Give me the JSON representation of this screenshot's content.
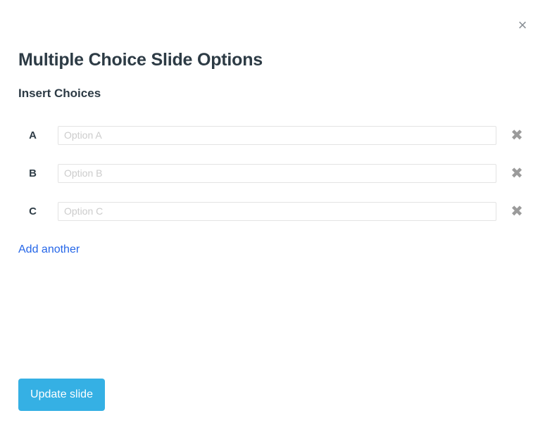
{
  "dialog": {
    "title": "Multiple Choice Slide Options",
    "section_title": "Insert Choices",
    "close_icon": "close-icon",
    "close_glyph": "×"
  },
  "choices": [
    {
      "letter": "A",
      "value": "",
      "placeholder": "Option A",
      "remove_glyph": "✖",
      "remove_icon": "remove-choice-icon"
    },
    {
      "letter": "B",
      "value": "",
      "placeholder": "Option B",
      "remove_glyph": "✖",
      "remove_icon": "remove-choice-icon"
    },
    {
      "letter": "C",
      "value": "",
      "placeholder": "Option C",
      "remove_glyph": "✖",
      "remove_icon": "remove-choice-icon"
    }
  ],
  "links": {
    "add_another": "Add another"
  },
  "footer": {
    "update_label": "Update slide"
  },
  "colors": {
    "link": "#2566e8",
    "primary_button": "#35b0e4",
    "heading": "#2d3b45",
    "placeholder": "#cccccc",
    "input_border": "#e3e3e3",
    "remove_icon": "#9b9b9b",
    "close_icon": "#8a9096"
  }
}
